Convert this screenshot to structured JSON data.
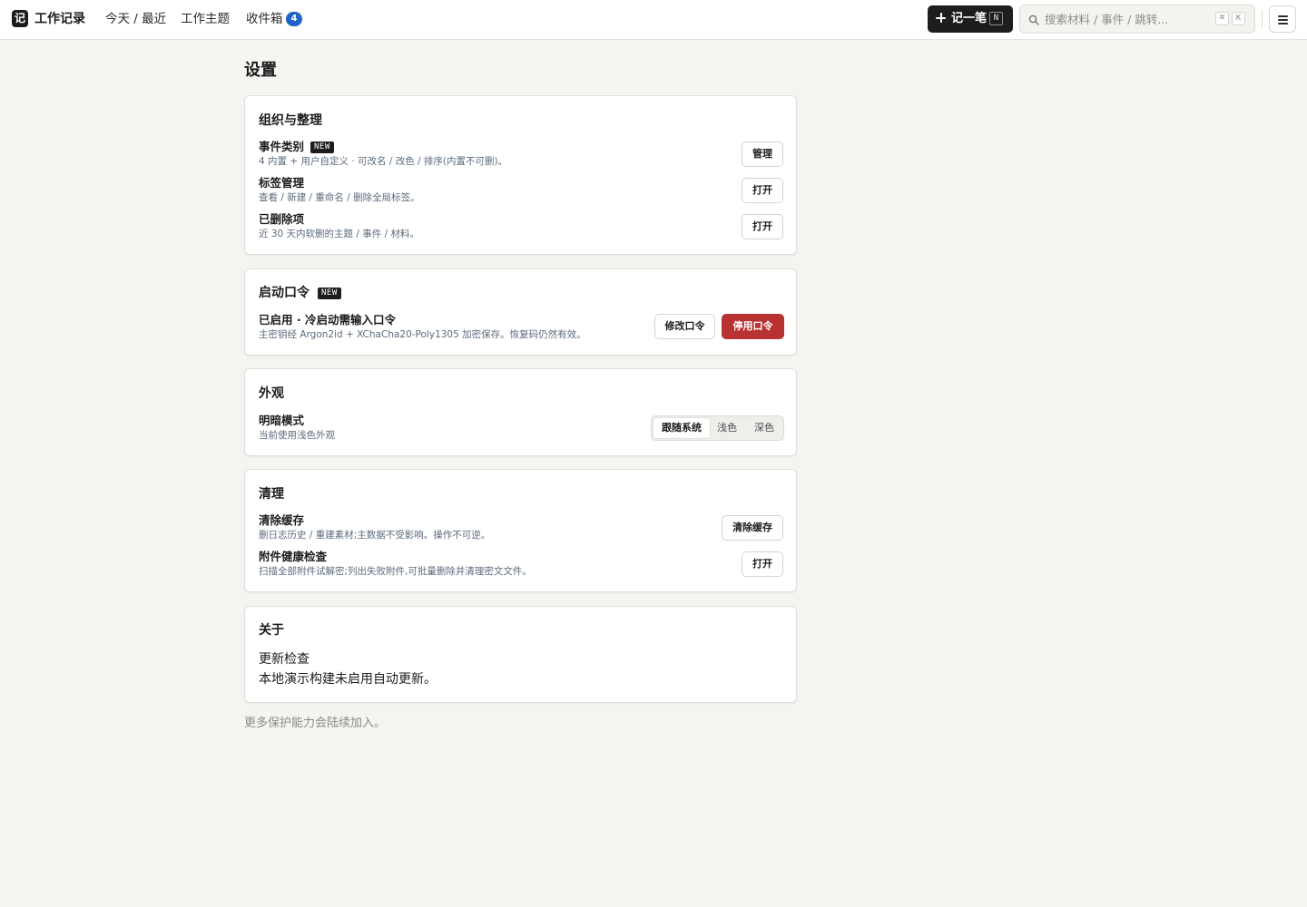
{
  "header": {
    "logo_glyph": "记",
    "app_title": "工作记录",
    "nav": {
      "today": "今天 / 最近",
      "topics": "工作主题",
      "inbox": "收件箱",
      "inbox_count": "4"
    },
    "new_entry": {
      "label": "记一笔",
      "shortcut": "N"
    },
    "search": {
      "placeholder": "搜索材料 / 事件 / 跳转...",
      "shortcut_mod": "⌘",
      "shortcut_key": "K"
    },
    "menu_icon": "hamburger-icon"
  },
  "page": {
    "title": "设置"
  },
  "organize": {
    "title": "组织与整理",
    "categories": {
      "title": "事件类别",
      "badge": "NEW",
      "desc": "4 内置 + 用户自定义 · 可改名 / 改色 / 排序(内置不可删)。",
      "button": "管理"
    },
    "tags": {
      "title": "标签管理",
      "desc": "查看 / 新建 / 重命名 / 删除全局标签。",
      "button": "打开"
    },
    "deleted": {
      "title": "已删除项",
      "desc": "近 30 天内软删的主题 / 事件 / 材料。",
      "button": "打开"
    }
  },
  "passcode": {
    "title": "启动口令",
    "badge": "NEW",
    "status": "已启用 · 冷启动需输入口令",
    "desc": "主密钥经 Argon2id + XChaCha20-Poly1305 加密保存。恢复码仍然有效。",
    "change_button": "修改口令",
    "disable_button": "停用口令"
  },
  "appearance": {
    "title": "外观",
    "mode_title": "明暗模式",
    "mode_desc": "当前使用浅色外观",
    "options": [
      "跟随系统",
      "浅色",
      "深色"
    ],
    "selected": "跟随系统"
  },
  "cleanup": {
    "title": "清理",
    "cache": {
      "title": "清除缓存",
      "desc": "删日志历史 / 重建素材;主数据不受影响。操作不可逆。",
      "button": "清除缓存"
    },
    "health": {
      "title": "附件健康检查",
      "desc": "扫描全部附件试解密;列出失败附件,可批量删除并清理密文文件。",
      "button": "打开"
    }
  },
  "about": {
    "title": "关于",
    "line1": "更新检查",
    "line2": "本地演示构建未启用自动更新。"
  },
  "footer": "更多保护能力会陆续加入。",
  "colors": {
    "background": "#f5f4f0",
    "accent_dark": "#1d1d1f",
    "badge_blue": "#1f64c8",
    "danger": "#b83232",
    "desc_text": "#5c6b7e"
  }
}
